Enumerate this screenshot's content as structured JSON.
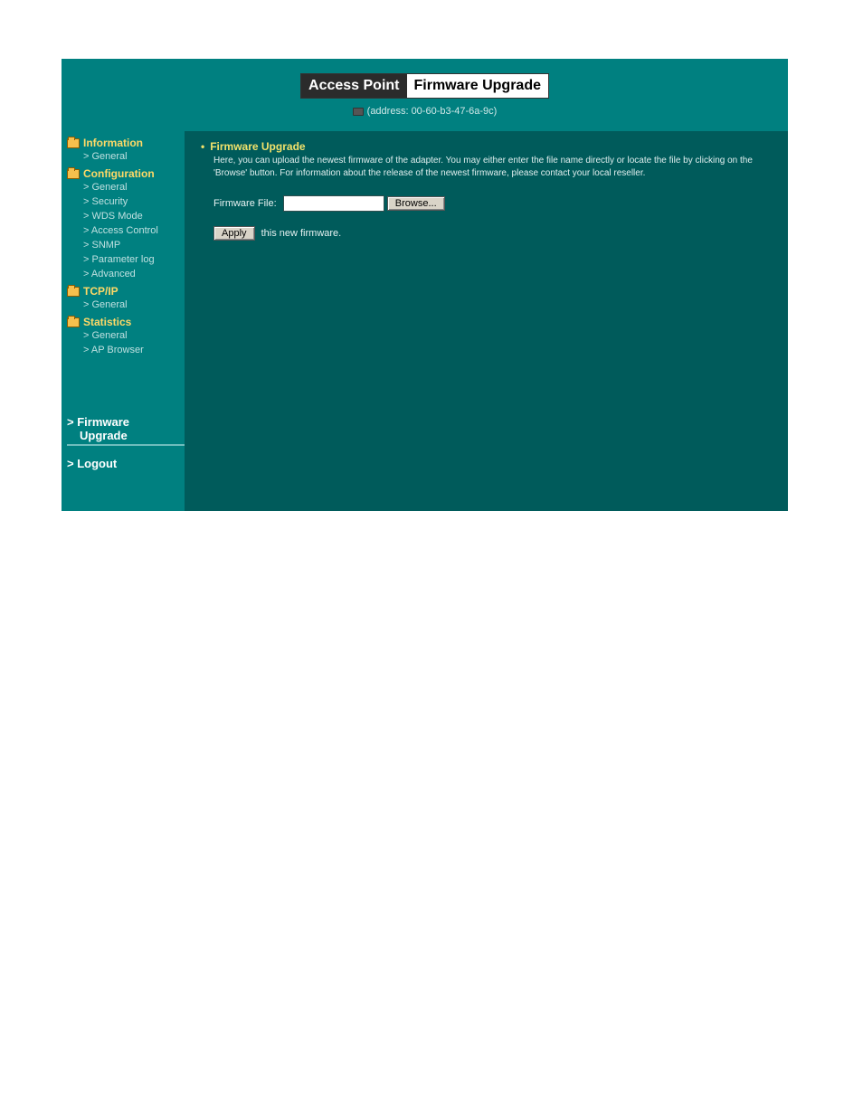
{
  "header": {
    "title_dark": "Access Point",
    "title_light": "Firmware Upgrade",
    "address_label": "(address: 00-60-b3-47-6a-9c)"
  },
  "sidebar": {
    "sections": [
      {
        "label": "Information",
        "items": [
          "General"
        ]
      },
      {
        "label": "Configuration",
        "items": [
          "General",
          "Security",
          "WDS Mode",
          "Access Control",
          "SNMP",
          "Parameter log",
          "Advanced"
        ]
      },
      {
        "label": "TCP/IP",
        "items": [
          "General"
        ]
      },
      {
        "label": "Statistics",
        "items": [
          "General",
          "AP Browser"
        ]
      }
    ],
    "firmware_line1": "Firmware",
    "firmware_line2": "Upgrade",
    "logout": "Logout"
  },
  "content": {
    "heading": "Firmware Upgrade",
    "description": "Here, you can upload the newest firmware of the adapter. You may either enter the file name directly or locate the file by clicking on the 'Browse' button. For information about the release of the newest firmware, please contact your local reseller.",
    "file_label": "Firmware File:",
    "file_value": "",
    "browse_label": "Browse...",
    "apply_label": "Apply",
    "apply_trail": "this new firmware."
  }
}
